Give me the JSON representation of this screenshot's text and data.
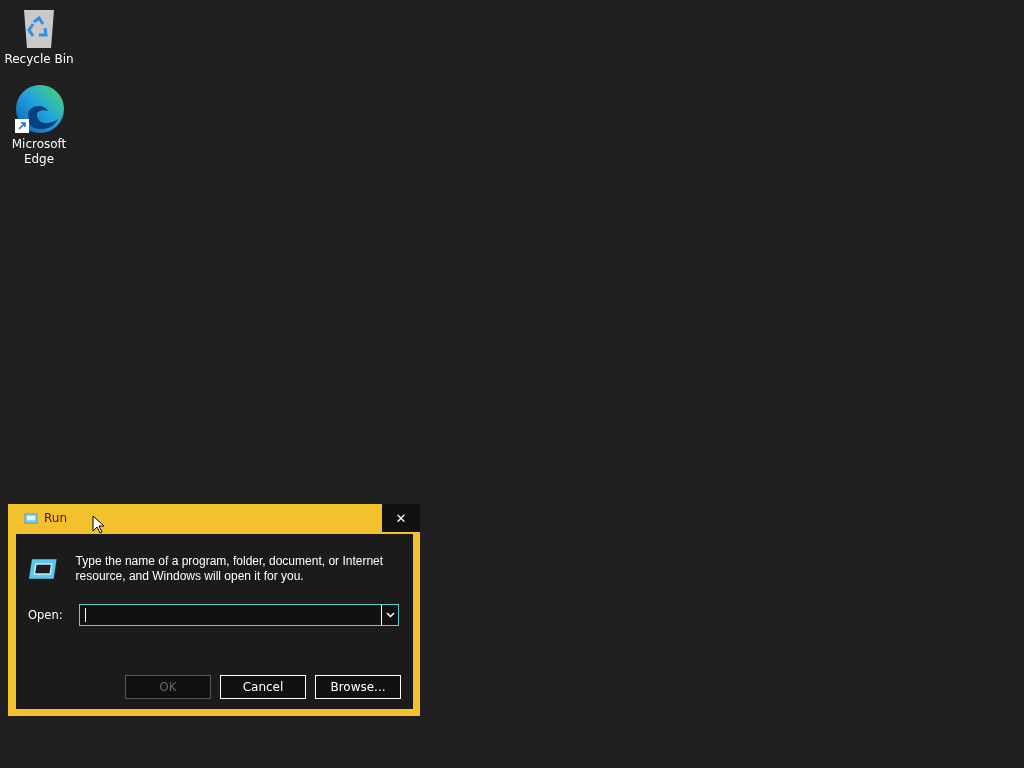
{
  "desktop_icons": [
    {
      "kind": "recycle-bin",
      "label": "Recycle Bin"
    },
    {
      "kind": "edge",
      "label": "Microsoft Edge"
    }
  ],
  "dialog": {
    "title": "Run",
    "close": "✕",
    "description": "Type the name of a program, folder, document, or Internet resource, and Windows will open it for you.",
    "open_label": "Open:",
    "buttons": [
      {
        "label": "OK",
        "disabled": true
      },
      {
        "label": "Cancel",
        "disabled": false
      },
      {
        "label": "Browse...",
        "disabled": false
      }
    ]
  }
}
